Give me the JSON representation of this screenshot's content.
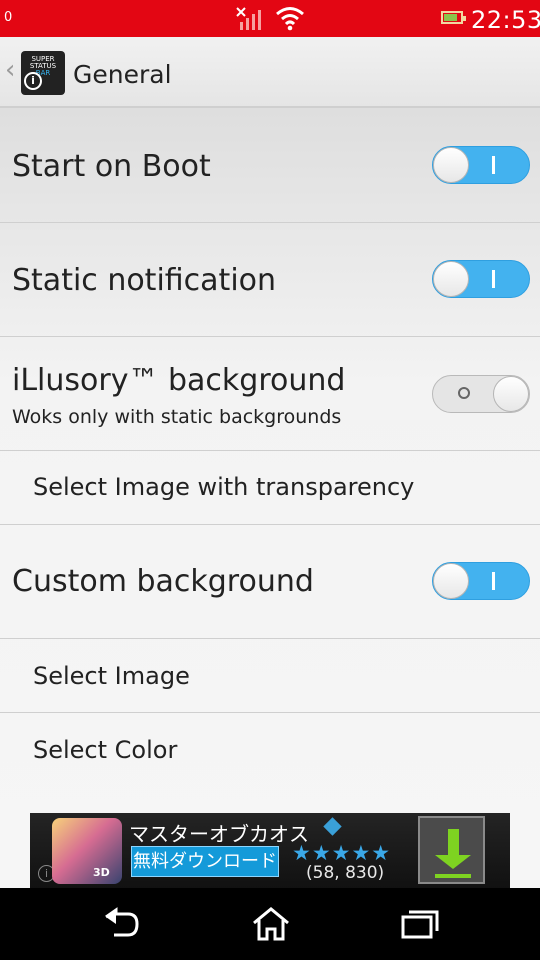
{
  "status_bar": {
    "left_text": "0",
    "clock": "22:53",
    "icons": [
      "signal-no-data-icon",
      "wifi-icon",
      "battery-icon"
    ],
    "battery_level": 0.8,
    "colors": {
      "background": "#e30613",
      "icons": "#ffffff"
    }
  },
  "action_bar": {
    "title": "General",
    "app_icon": {
      "lines": [
        "SUPER",
        "STATUS",
        "BAR"
      ],
      "badge": "i"
    }
  },
  "settings": {
    "start_on_boot": {
      "title": "Start on Boot",
      "toggle_on": true
    },
    "static_notification": {
      "title": "Static notification",
      "toggle_on": true
    },
    "illusory_background": {
      "title": "iLlusory™ background",
      "subtitle": "Woks only with static backgrounds",
      "toggle_on": false
    },
    "select_image_transparency": {
      "label": "Select Image with transparency"
    },
    "custom_background": {
      "title": "Custom background",
      "toggle_on": true
    },
    "select_image": {
      "label": "Select Image"
    },
    "select_color": {
      "label": "Select Color"
    }
  },
  "ad": {
    "title": "マスターオブカオス",
    "button": "無料ダウンロード",
    "rating_stars": "★★★★★",
    "rating_value": 4.5,
    "rating_count": "(58, 830)",
    "image_badge": "3D",
    "info_badge": "i"
  },
  "navigation": {
    "back_icon": "back-icon",
    "home_icon": "home-icon",
    "recents_icon": "recent-apps-icon"
  },
  "colors": {
    "accent": "#43b2ef",
    "toggle_off": "#e5e5e5",
    "text": "#222222"
  }
}
